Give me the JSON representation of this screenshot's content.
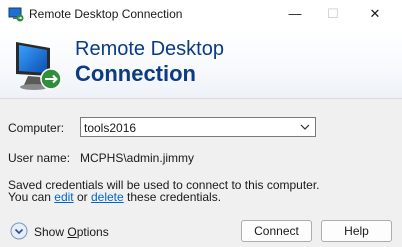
{
  "window": {
    "title": "Remote Desktop Connection",
    "controls": {
      "minimize": "—",
      "maximize": "☐",
      "close": "✕"
    }
  },
  "banner": {
    "line1": "Remote Desktop",
    "line2": "Connection"
  },
  "form": {
    "computer_label": "Computer:",
    "computer_value": "tools2016",
    "username_label": "User name:",
    "username_value": "MCPHS\\admin.jimmy",
    "credentials_line1": "Saved credentials will be used to connect to this computer.",
    "credentials_prefix": "You can ",
    "edit_link": "edit",
    "or_text": " or ",
    "delete_link": "delete",
    "credentials_suffix": " these credentials."
  },
  "footer": {
    "show_options_pre": "Show ",
    "show_options_accel": "O",
    "show_options_post": "ptions",
    "connect_label": "Connect",
    "help_label": "Help"
  },
  "colors": {
    "accent": "#0b3b83",
    "link": "#0066cc",
    "background": "#f0f0f0"
  },
  "icons": {
    "app": "remote-desktop-icon",
    "banner": "monitor-remote-icon",
    "combo": "chevron-down-icon",
    "options": "chevron-circle-down-icon"
  }
}
